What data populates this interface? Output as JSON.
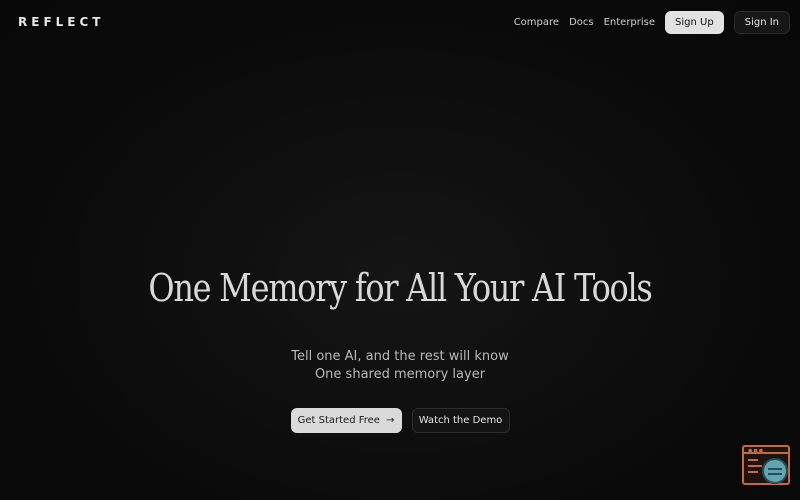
{
  "nav": {
    "logo": "REFLECT",
    "links": [
      "Compare",
      "Docs",
      "Enterprise"
    ],
    "sign_up": "Sign Up",
    "sign_in": "Sign In"
  },
  "hero": {
    "title": "One Memory for All Your AI Tools",
    "subtitle_line1": "Tell one AI, and the rest will know",
    "subtitle_line2": "One shared memory layer",
    "primary_cta": "Get Started Free",
    "primary_cta_icon": "arrow-right-icon",
    "secondary_cta": "Watch the Demo"
  },
  "widget": {
    "icon": "chat-widget-icon",
    "accent_color": "#c56a3c",
    "circle_color": "#5fa6b0"
  }
}
